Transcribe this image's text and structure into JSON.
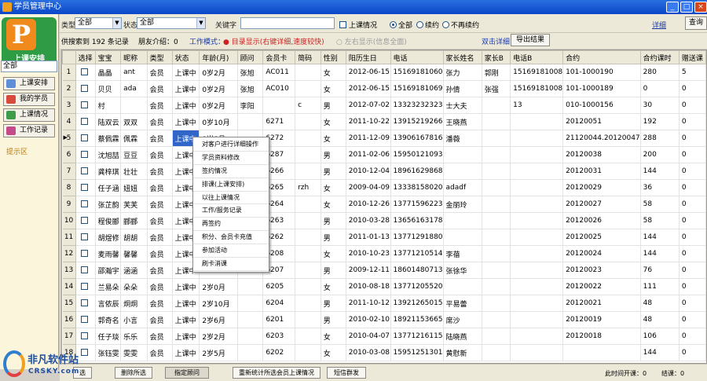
{
  "window": {
    "title": "学员管理中心",
    "controls": [
      "_",
      "□",
      "×"
    ]
  },
  "left": {
    "logo_letter": "P",
    "logo_caption": "上课安排",
    "select_value": "全部",
    "buttons": [
      "上课安排",
      "我的学员",
      "上课情况",
      "工作记录"
    ],
    "tip": "提示区"
  },
  "filters": {
    "type_label": "类型",
    "type_value": "全部",
    "status_label": "状态",
    "status_value": "全部",
    "keyword_label": "关键字",
    "keyword_value": "",
    "class_check": "上课情况",
    "radio_all": "全部",
    "radio_renew": "续约",
    "radio_norenew": "不再续约",
    "detail": "详细",
    "query": "查询"
  },
  "info": {
    "search_text": "供搜索到 192 条记录",
    "share_text": "朋友介绍：0",
    "mode_text": "工作模式：",
    "mode_red": "● 目录显示(右键详细,速度较快)",
    "mode_gray": "○ 左右显示(信息全面)",
    "dblclick": "双击详细",
    "export": "导出结果"
  },
  "grid": {
    "columns": [
      "",
      "选择",
      "宝宝",
      "昵称",
      "类型",
      "状态",
      "年龄(月)",
      "顾问",
      "会员卡",
      "简码",
      "性别",
      "阳历生日",
      "电话",
      "家长姓名",
      "家长B",
      "电话B",
      "合约",
      "合约课时",
      "赠送课"
    ],
    "rows": [
      [
        "1",
        "",
        "晶晶",
        "ant",
        "会员",
        "上课中",
        "0岁2月",
        "张旭",
        "AC011",
        "",
        "女",
        "2012-06-15",
        "15169181060",
        "张力",
        "郭刚",
        "15169181008",
        "101-1000190",
        "280",
        "5"
      ],
      [
        "2",
        "",
        "贝贝",
        "ada",
        "会员",
        "上课中",
        "0岁2月",
        "张旭",
        "AC010",
        "",
        "女",
        "2012-06-15",
        "15169181069",
        "孙倩",
        "张强",
        "15169181008",
        "101-1000189",
        "0",
        "0"
      ],
      [
        "3",
        "",
        "村",
        "",
        "会员",
        "上课中",
        "0岁2月",
        "李阳",
        "",
        "c",
        "男",
        "2012-07-02",
        "13323232323",
        "士大夫",
        "",
        "13",
        "010-1000156",
        "30",
        "0"
      ],
      [
        "4",
        "",
        "陆双云",
        "双双",
        "会员",
        "上课中",
        "0岁10月",
        "",
        "6271",
        "",
        "女",
        "2011-10-22",
        "13915219266",
        "王晓燕",
        "",
        "",
        "20120051",
        "192",
        "0"
      ],
      [
        "5",
        "",
        "蔡佩霖",
        "佩霖",
        "会员",
        "上课中",
        "0岁8月",
        "",
        "6272",
        "",
        "女",
        "2011-12-09",
        "13906167816",
        "潘薇",
        "",
        "",
        "21120044.20120047",
        "288",
        "0"
      ],
      [
        "6",
        "",
        "沈旭喆",
        "豆豆",
        "会员",
        "上课中",
        "",
        "",
        "6287",
        "",
        "男",
        "2011-02-06",
        "15950121093",
        "",
        "",
        "",
        "20120038",
        "200",
        "0"
      ],
      [
        "7",
        "",
        "龚梓琪",
        "壮壮",
        "会员",
        "上课中",
        "",
        "",
        "6266",
        "",
        "男",
        "2010-12-04",
        "18961629868",
        "",
        "",
        "",
        "20120031",
        "144",
        "0"
      ],
      [
        "8",
        "",
        "任子涵",
        "妞妞",
        "会员",
        "上课中",
        "",
        "",
        "6265",
        "rzh",
        "女",
        "2009-04-09",
        "13338158020",
        "adadf",
        "",
        "",
        "20120029",
        "36",
        "0"
      ],
      [
        "9",
        "",
        "张芷韵",
        "芙芙",
        "会员",
        "上课中",
        "",
        "",
        "6264",
        "",
        "女",
        "2010-12-26",
        "13771596223",
        "金丽玲",
        "",
        "",
        "20120027",
        "58",
        "0"
      ],
      [
        "10",
        "",
        "程俊郦",
        "郦郦",
        "会员",
        "上课中",
        "",
        "",
        "6263",
        "",
        "男",
        "2010-03-28",
        "13656163178",
        "",
        "",
        "",
        "20120026",
        "58",
        "0"
      ],
      [
        "11",
        "",
        "胡煜修",
        "胡胡",
        "会员",
        "上课中",
        "",
        "",
        "6262",
        "",
        "男",
        "2011-01-13",
        "13771291880",
        "",
        "",
        "",
        "20120025",
        "144",
        "0"
      ],
      [
        "12",
        "",
        "麦雨馨",
        "馨馨",
        "会员",
        "上课中",
        "",
        "",
        "6208",
        "",
        "女",
        "2010-10-23",
        "13771210514",
        "李蓓",
        "",
        "",
        "20120024",
        "144",
        "0"
      ],
      [
        "13",
        "",
        "邵瀚宇",
        "涵涵",
        "会员",
        "上课中",
        "",
        "",
        "6207",
        "",
        "男",
        "2009-12-11",
        "18601480713",
        "张徐华",
        "",
        "",
        "20120023",
        "76",
        "0"
      ],
      [
        "14",
        "",
        "兰易朵",
        "朵朵",
        "会员",
        "上课中",
        "2岁0月",
        "",
        "6205",
        "",
        "女",
        "2010-08-18",
        "13771205520",
        "",
        "",
        "",
        "20120022",
        "111",
        "0"
      ],
      [
        "15",
        "",
        "言侬辰",
        "炯炯",
        "会员",
        "上课中",
        "2岁10月",
        "",
        "6204",
        "",
        "男",
        "2011-10-12",
        "13921265015",
        "平易蕾",
        "",
        "",
        "20120021",
        "48",
        "0"
      ],
      [
        "16",
        "",
        "郭奇名",
        "小言",
        "会员",
        "上课中",
        "2岁6月",
        "",
        "6201",
        "",
        "男",
        "2010-02-10",
        "18921153665",
        "席沙",
        "",
        "",
        "20120019",
        "48",
        "0"
      ],
      [
        "17",
        "",
        "任子琰",
        "乐乐",
        "会员",
        "上课中",
        "2岁2月",
        "",
        "6203",
        "",
        "女",
        "2010-04-07",
        "13771216115",
        "陆晓燕",
        "",
        "",
        "20120018",
        "106",
        "0"
      ],
      [
        "18",
        "",
        "张钰雯",
        "雯雯",
        "会员",
        "上课中",
        "2岁5月",
        "",
        "6202",
        "",
        "女",
        "2010-03-08",
        "15951251301",
        "黄慰新",
        "",
        "",
        "",
        "144",
        "0"
      ]
    ]
  },
  "context_menu": [
    "对客户进行详细操作",
    "学员资料修改",
    "签约情况",
    "排课(上课安排)",
    "以往上课情况",
    "工作/服务记录",
    "再签约",
    "积分、会员卡充值",
    "参加活动",
    "刷卡消课"
  ],
  "bottom": {
    "buttons": [
      "选",
      "删除所选",
      "指定顾问",
      "重新统计所选会员上课情况",
      "短信群发"
    ],
    "stat1": "此时间开课：0",
    "stat2": "结课：0"
  },
  "watermark": {
    "title": "非凡软件站",
    "sub": "CRSKY.com"
  },
  "colors": {
    "title_bar": "#0b46c8",
    "logo_green": "#2f9c45",
    "logo_orange": "#f08a1c",
    "selection": "#3166c8",
    "mode_text": "#d02020"
  }
}
